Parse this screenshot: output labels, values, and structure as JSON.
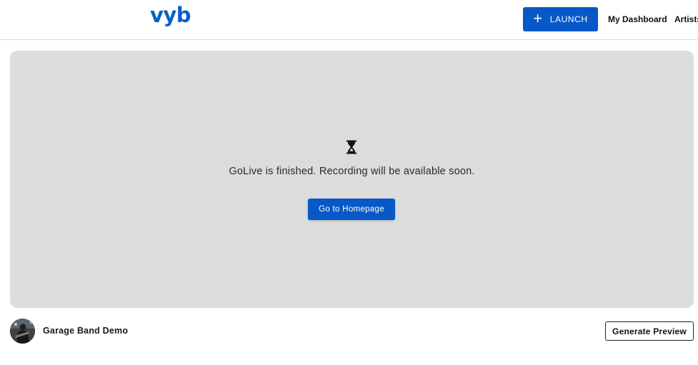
{
  "header": {
    "logo_text": "vyb",
    "launch_label": "LAUNCH",
    "nav": [
      {
        "label": "My Dashboard"
      },
      {
        "label": "Artists"
      }
    ]
  },
  "stage": {
    "status_icon": "hourglass-icon",
    "message": "GoLive is finished. Recording will be available soon.",
    "home_button_label": "Go to Homepage"
  },
  "event": {
    "title": "Garage Band Demo",
    "generate_preview_label": "Generate Preview"
  },
  "colors": {
    "brand_blue": "#0758c8",
    "stage_bg": "#dcdcdc"
  }
}
